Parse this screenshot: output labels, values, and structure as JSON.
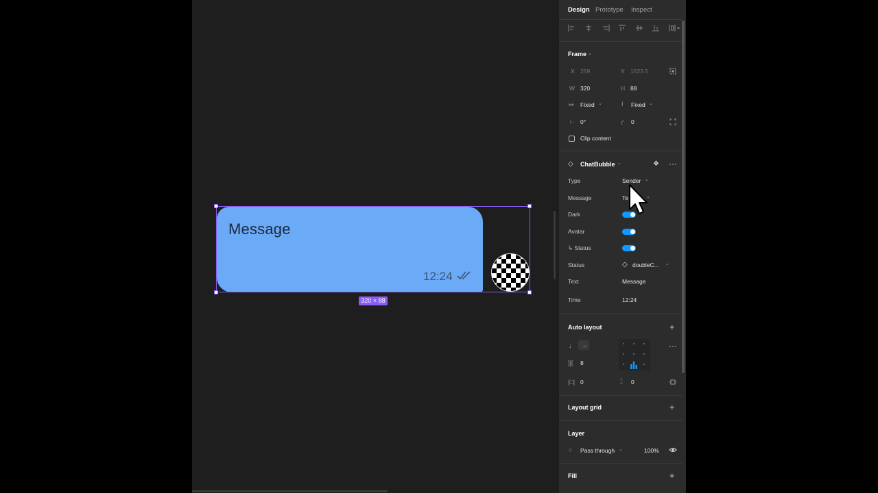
{
  "canvas": {
    "bubble": {
      "message": "Message",
      "time": "12:24"
    },
    "size_badge": "320 × 88"
  },
  "panel": {
    "tabs": [
      "Design",
      "Prototype",
      "Inspect"
    ],
    "frame": {
      "title": "Frame",
      "x_label": "X",
      "x_value": "259",
      "y_label": "Y",
      "y_value": "1623.5",
      "w_label": "W",
      "w_value": "320",
      "h_label": "H",
      "h_value": "88",
      "width_mode": "Fixed",
      "height_mode": "Fixed",
      "rotation": "0°",
      "radius": "0",
      "clip_content": "Clip content"
    },
    "component": {
      "name": "ChatBubble",
      "props": {
        "type_label": "Type",
        "type_value": "Sender",
        "message_label": "Message",
        "message_value": "Te…ll",
        "dark_label": "Dark",
        "avatar_label": "Avatar",
        "status_toggle_label": "↳ Status",
        "status_label": "Status",
        "status_value": "doubleC...",
        "text_label": "Text",
        "text_value": "Message",
        "time_label": "Time",
        "time_value": "12:24"
      }
    },
    "auto_layout": {
      "title": "Auto layout",
      "gap": "8",
      "padding_h": "0",
      "padding_v": "0"
    },
    "layout_grid": {
      "title": "Layout grid"
    },
    "layer": {
      "title": "Layer",
      "blend": "Pass through",
      "opacity": "100%"
    },
    "fill": {
      "title": "Fill"
    }
  }
}
